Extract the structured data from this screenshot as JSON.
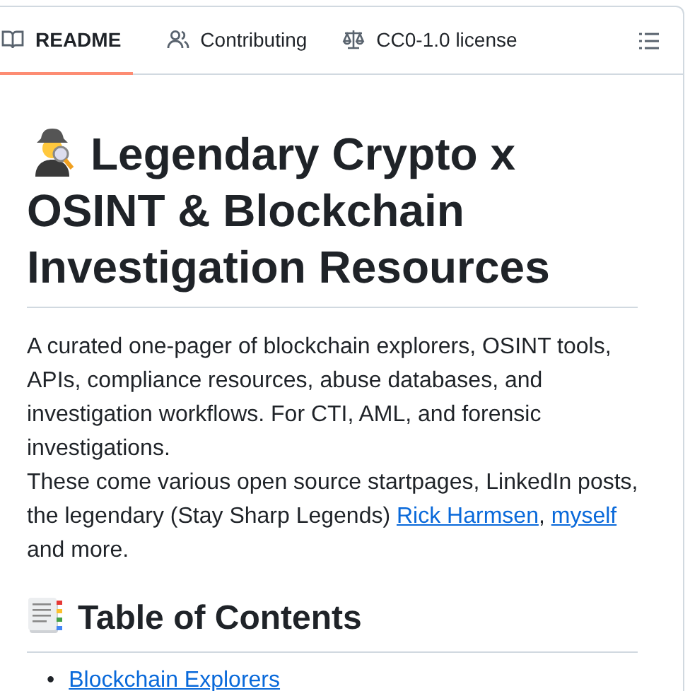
{
  "tabs": [
    {
      "label": "README",
      "kind": "book",
      "selected": true
    },
    {
      "label": "Contributing",
      "kind": "people",
      "selected": false
    },
    {
      "label": "CC0-1.0 license",
      "kind": "scale",
      "selected": false
    }
  ],
  "title_lines": [
    "Legendary Crypto x",
    "OSINT & Blockchain",
    "Investigation Resources"
  ],
  "paragraphs": [
    [
      {
        "kind": "text",
        "text": "A curated one-pager of blockchain explorers, OSINT tools, APIs, compliance resources, abuse databases, and investigation workflows. For CTI, AML, and forensic investigations."
      }
    ],
    [
      {
        "kind": "text",
        "text": "These come various open source startpages, LinkedIn posts, the legendary (Stay Sharp Legends) "
      },
      {
        "kind": "link",
        "text": "Rick Harmsen"
      },
      {
        "kind": "text",
        "text": ", "
      },
      {
        "kind": "link",
        "text": "myself"
      },
      {
        "kind": "text",
        "text": " and more."
      }
    ]
  ],
  "toc": {
    "heading": "Table of Contents",
    "items": [
      {
        "marker": "•",
        "text": "Blockchain Explorers"
      }
    ]
  }
}
